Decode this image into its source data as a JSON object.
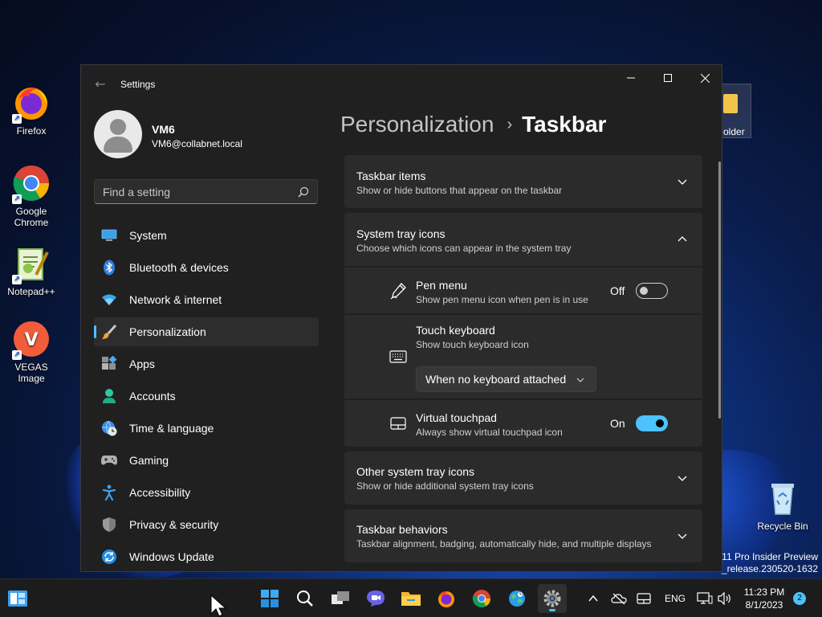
{
  "desktop": {
    "icons": [
      {
        "name": "firefox",
        "label": "Firefox"
      },
      {
        "name": "chrome",
        "label": "Google Chrome"
      },
      {
        "name": "notepadpp",
        "label": "Notepad++"
      },
      {
        "name": "vegas",
        "label": "VEGAS Image"
      },
      {
        "name": "recycle-bin",
        "label": "Recycle Bin"
      }
    ],
    "folder_label": "older",
    "watermark_line1": "11 Pro Insider Preview",
    "watermark_line2": "zn_release.230520-1632",
    "vegas_letter": "V"
  },
  "window": {
    "title": "Settings",
    "back_glyph": "←"
  },
  "user": {
    "name": "VM6",
    "email": "VM6@collabnet.local"
  },
  "search": {
    "placeholder": "Find a setting",
    "value": ""
  },
  "nav": {
    "items": [
      {
        "label": "System",
        "icon": "monitor-icon"
      },
      {
        "label": "Bluetooth & devices",
        "icon": "bluetooth-icon"
      },
      {
        "label": "Network & internet",
        "icon": "wifi-icon"
      },
      {
        "label": "Personalization",
        "icon": "brush-icon",
        "active": true
      },
      {
        "label": "Apps",
        "icon": "apps-icon"
      },
      {
        "label": "Accounts",
        "icon": "person-icon"
      },
      {
        "label": "Time & language",
        "icon": "clock-globe-icon"
      },
      {
        "label": "Gaming",
        "icon": "gamepad-icon"
      },
      {
        "label": "Accessibility",
        "icon": "accessibility-icon"
      },
      {
        "label": "Privacy & security",
        "icon": "shield-icon"
      },
      {
        "label": "Windows Update",
        "icon": "update-icon"
      }
    ]
  },
  "breadcrumb": {
    "parent": "Personalization",
    "separator": "›",
    "current": "Taskbar"
  },
  "sections": {
    "taskbar_items": {
      "title": "Taskbar items",
      "subtitle": "Show or hide buttons that appear on the taskbar"
    },
    "system_tray": {
      "title": "System tray icons",
      "subtitle": "Choose which icons can appear in the system tray"
    },
    "pen_menu": {
      "title": "Pen menu",
      "desc": "Show pen menu icon when pen is in use",
      "state": "Off"
    },
    "touch_keyboard": {
      "title": "Touch keyboard",
      "desc": "Show touch keyboard icon",
      "dropdown_value": "When no keyboard attached"
    },
    "virtual_touchpad": {
      "title": "Virtual touchpad",
      "desc": "Always show virtual touchpad icon",
      "state": "On"
    },
    "other_tray": {
      "title": "Other system tray icons",
      "subtitle": "Show or hide additional system tray icons"
    },
    "behaviors": {
      "title": "Taskbar behaviors",
      "subtitle": "Taskbar alignment, badging, automatically hide, and multiple displays"
    }
  },
  "taskbar": {
    "language": "ENG",
    "time": "11:23 PM",
    "date": "8/1/2023",
    "notification_count": "2"
  },
  "colors": {
    "accent": "#4cc2ff",
    "window_bg": "#202020",
    "card_bg": "#2b2b2b"
  }
}
